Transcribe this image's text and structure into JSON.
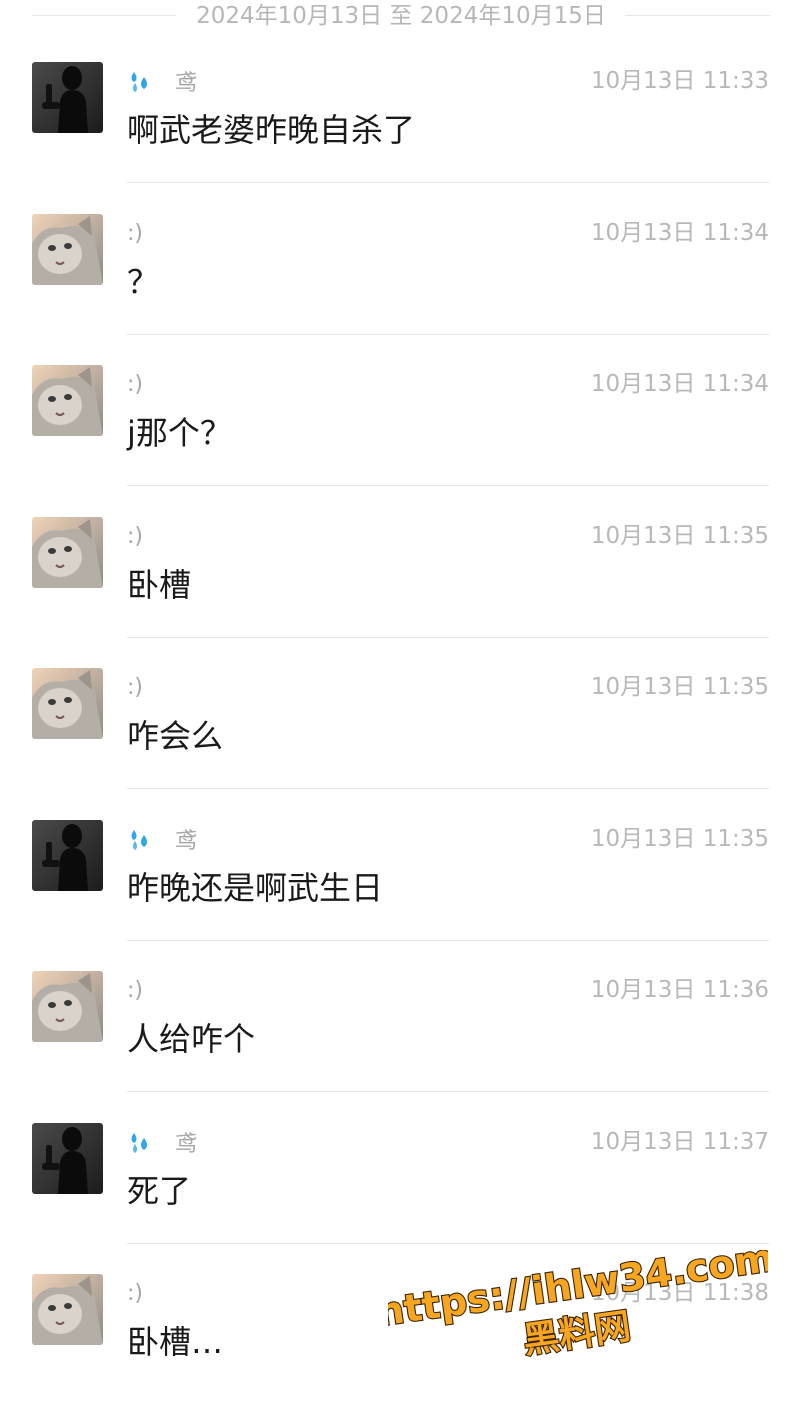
{
  "date_range": "2024年10月13日 至 2024年10月15日",
  "messages": [
    {
      "avatar": "silhouette-avatar",
      "sender_icon": "droplets-icon",
      "sender": "鸢",
      "time": "10月13日 11:33",
      "text": "啊武老婆昨晚自杀了"
    },
    {
      "avatar": "cat-avatar",
      "sender_icon": "",
      "sender": ":)",
      "time": "10月13日 11:34",
      "text": "？"
    },
    {
      "avatar": "cat-avatar",
      "sender_icon": "",
      "sender": ":)",
      "time": "10月13日 11:34",
      "text": "j那个？"
    },
    {
      "avatar": "cat-avatar",
      "sender_icon": "",
      "sender": ":)",
      "time": "10月13日 11:35",
      "text": "卧槽"
    },
    {
      "avatar": "cat-avatar",
      "sender_icon": "",
      "sender": ":)",
      "time": "10月13日 11:35",
      "text": "咋会么"
    },
    {
      "avatar": "silhouette-avatar",
      "sender_icon": "droplets-icon",
      "sender": "鸢",
      "time": "10月13日 11:35",
      "text": "昨晚还是啊武生日"
    },
    {
      "avatar": "cat-avatar",
      "sender_icon": "",
      "sender": ":)",
      "time": "10月13日 11:36",
      "text": "人给咋个"
    },
    {
      "avatar": "silhouette-avatar",
      "sender_icon": "droplets-icon",
      "sender": "鸢",
      "time": "10月13日 11:37",
      "text": "死了"
    },
    {
      "avatar": "cat-avatar",
      "sender_icon": "",
      "sender": ":)",
      "time": "10月13日 11:38",
      "text": "卧槽…"
    }
  ],
  "watermark": {
    "line1": "https://ihlw34.com",
    "line2": "黑料网",
    "fill": "#f7a621",
    "stroke": "#3a2200"
  },
  "colors": {
    "sender_icon": "#2fa6e8",
    "divider": "#e6e6e6"
  }
}
